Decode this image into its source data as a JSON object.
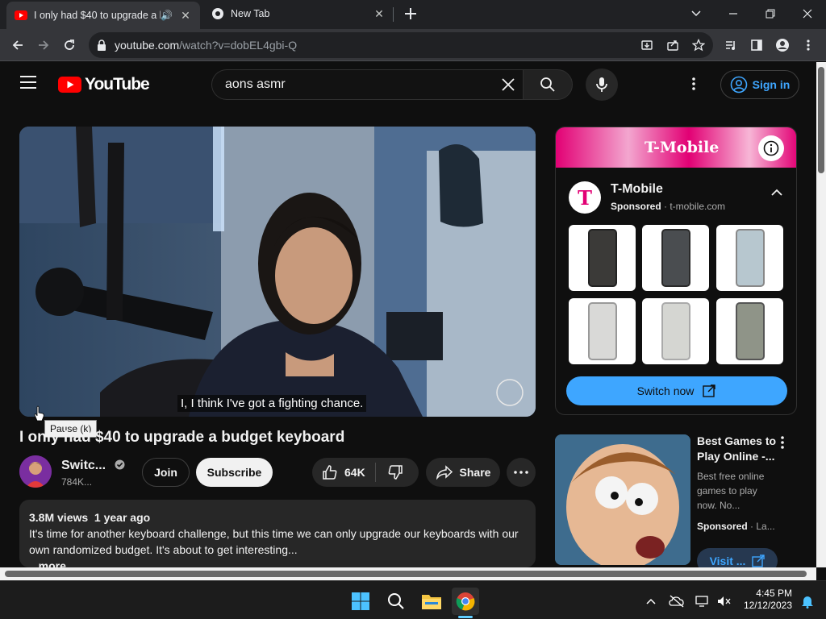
{
  "browser": {
    "tabs": [
      {
        "label": "I only had $40 to upgrade a b",
        "active": true
      },
      {
        "label": "New Tab",
        "active": false
      }
    ],
    "url_host": "youtube.com",
    "url_path": "/watch?v=dobEL4gbi-Q"
  },
  "youtube": {
    "logo_text": "YouTube",
    "search_query": "aons asmr",
    "signin_label": "Sign in",
    "caption": "I, I think I've got a fighting chance.",
    "tooltip": "Pause (k)",
    "video_title": "I only had $40 to upgrade a budget keyboard",
    "channel_name": "Switc...",
    "channel_subs": "784K...",
    "join_label": "Join",
    "subscribe_label": "Subscribe",
    "like_count": "64K",
    "share_label": "Share",
    "views_meta": "3.8M views  1 year ago",
    "description": "It's time for another keyboard challenge, but this time we can only upgrade our keyboards with our own randomized budget. It's about to get interesting...",
    "desc_more": "...more"
  },
  "ad": {
    "banner_text": "T-Mobile",
    "logo_letter": "T",
    "name": "T-Mobile",
    "sponsored": "Sponsored",
    "domain": "t-mobile.com",
    "cta": "Switch now",
    "brand_color": "#e20074"
  },
  "ad2": {
    "title": "Best Games to Play Online -...",
    "desc": "Best free online games to play now. No...",
    "sponsored": "Sponsored",
    "advertiser": "La...",
    "cta": "Visit ..."
  },
  "taskbar": {
    "time": "4:45 PM",
    "date": "12/12/2023"
  }
}
